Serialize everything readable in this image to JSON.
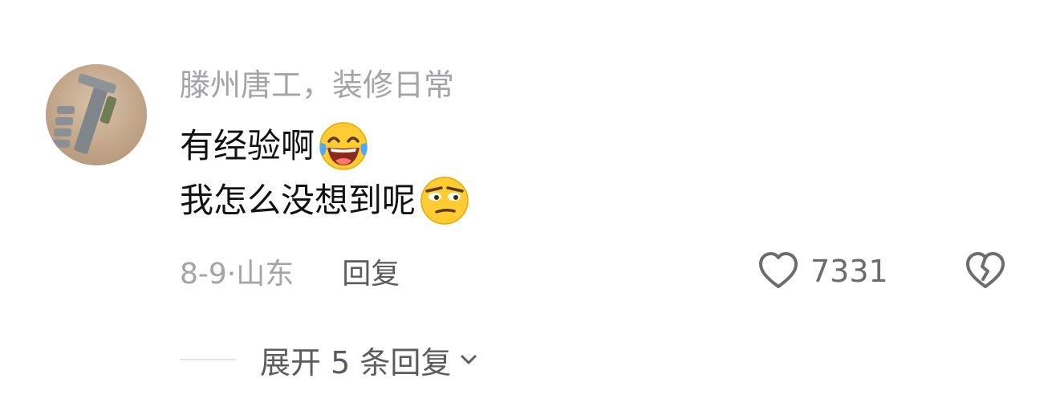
{
  "comment": {
    "username": "滕州唐工，装修日常",
    "content_lines": [
      "有经验啊",
      "我怎么没想到呢"
    ],
    "emojis": [
      "laughing-crying-emoji",
      "skeptical-smirk-emoji"
    ],
    "date_location": "8-9·山东",
    "reply_label": "回复",
    "like_count": "7331",
    "icons": {
      "like": "heart-outline-icon",
      "dislike": "broken-heart-icon",
      "expand": "chevron-down-icon"
    }
  },
  "replies": {
    "expand_label": "展开 5 条回复"
  },
  "colors": {
    "username": "#a3a3a8",
    "content": "#111111",
    "secondary": "#5b5b60"
  }
}
